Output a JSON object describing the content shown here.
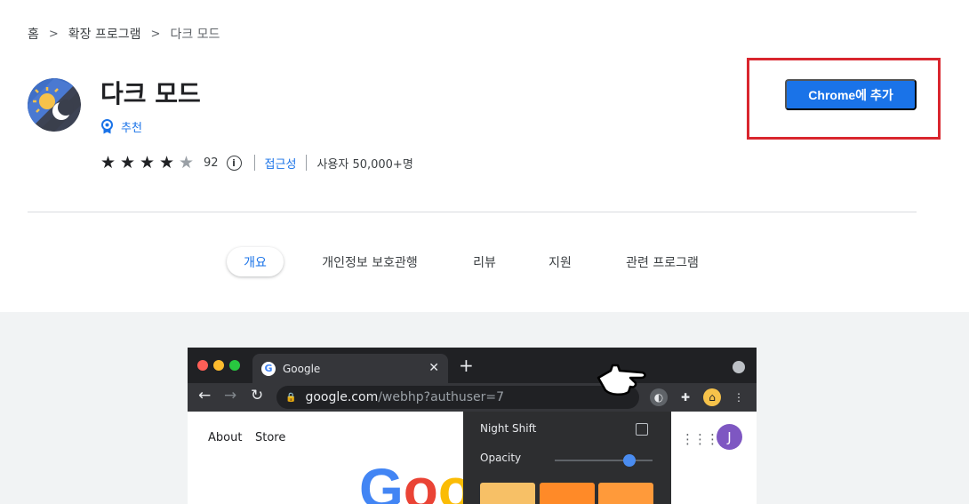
{
  "breadcrumb": {
    "home": "홈",
    "separator": ">",
    "category": "확장 프로그램",
    "current": "다크 모드"
  },
  "extension": {
    "icon": "dark-mode-sun-moon-icon",
    "title": "다크 모드",
    "featured_label": "추천",
    "rating": 4.5,
    "rating_count": "92",
    "info_icon": "info-icon",
    "accessibility_label": "접근성",
    "users_label": "사용자 50,000+명"
  },
  "add_button_label": "Chrome에 추가",
  "colors": {
    "accent": "#1a73e8",
    "highlight_border": "#d9262e",
    "gallery_bg": "#f1f3f4"
  },
  "tabs": [
    {
      "label": "개요",
      "active": true
    },
    {
      "label": "개인정보 보호관행",
      "active": false
    },
    {
      "label": "리뷰",
      "active": false
    },
    {
      "label": "지원",
      "active": false
    },
    {
      "label": "관련 프로그램",
      "active": false
    }
  ],
  "screenshot": {
    "browser_tab_title": "Google",
    "url_host": "google.com",
    "url_path": "/webhp?authuser=7",
    "page_links": [
      "About",
      "Store"
    ],
    "avatar_letter": "J",
    "logo_text": "Goo",
    "popup": {
      "night_shift_label": "Night Shift",
      "night_shift_checked": false,
      "opacity_label": "Opacity",
      "opacity_level": 0.8,
      "swatch_colors": [
        "#f7c066",
        "#ff8a28",
        "#ff9a3a"
      ]
    }
  }
}
